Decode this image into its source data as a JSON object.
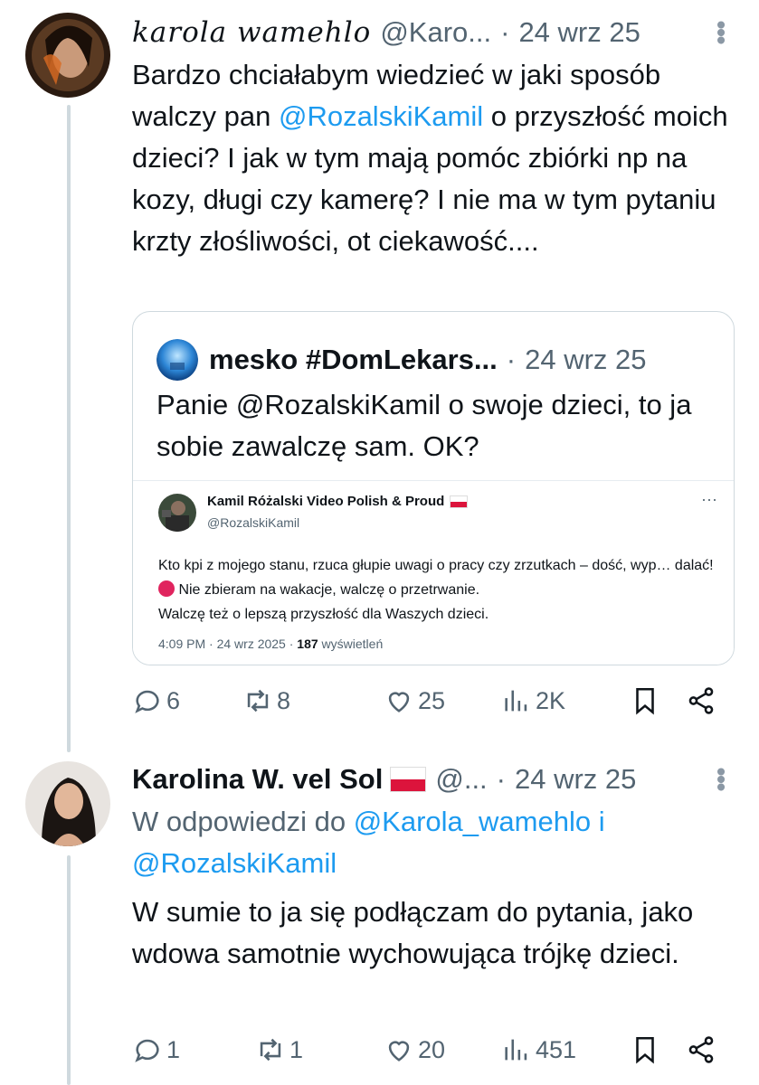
{
  "tweet1": {
    "author_name": "karola wamehlo",
    "handle": "@Karo...",
    "separator": "·",
    "date": "24 wrz 25",
    "text_pre": "Bardzo chciałabym wiedzieć w jaki sposób walczy pan ",
    "mention": "@RozalskiKamil",
    "text_post": " o przyszłość moich dzieci? I jak w tym mają pomóc zbiórki np na kozy, długi czy kamerę? I nie ma w tym pytaniu krzty złośliwości, ot ciekawość....",
    "quote": {
      "author_name": "mesko #DomLekars...",
      "separator": "·",
      "date": "24 wrz 25",
      "text": "Panie @RozalskiKamil o swoje dzieci, to ja sobie zawalczę sam. OK?",
      "embedded": {
        "name": "Kamil Różalski Video Polish & Proud",
        "handle": "@RozalskiKamil",
        "more": "···",
        "line1": "Kto kpi z mojego stanu, rzuca głupie uwagi o pracy czy zrzutkach – dość, wyp… dalać!",
        "line2": " Nie zbieram na wakacje, walczę o przetrwanie.",
        "line3": "Walczę też o lepszą przyszłość dla Waszych dzieci.",
        "meta_time": "4:09 PM · 24 wrz 2025 · ",
        "meta_views": "187",
        "meta_views_label": " wyświetleń"
      }
    },
    "actions": {
      "replies": "6",
      "reposts": "8",
      "likes": "25",
      "views": "2K"
    }
  },
  "tweet2": {
    "author_name": "Karolina W. vel Sol",
    "handle": "@...",
    "separator": "·",
    "date": "24 wrz 25",
    "reply_prefix": "W odpowiedzi do ",
    "reply_to_1": "@Karola_wamehlo",
    "reply_and": " i",
    "reply_to_2": "@RozalskiKamil",
    "text": "W sumie to ja się podłączam do pytania, jako wdowa samotnie wychowująca trójkę dzieci.",
    "actions": {
      "replies": "1",
      "reposts": "1",
      "likes": "20",
      "views": "451"
    }
  },
  "icons": {
    "more": "more-vertical-icon",
    "reply": "reply-icon",
    "repost": "repost-icon",
    "like": "heart-icon",
    "views": "views-chart-icon",
    "bookmark": "bookmark-icon",
    "share": "share-icon"
  },
  "colors": {
    "accent": "#1d9bf0",
    "muted": "#536471",
    "border": "#cfd9de"
  }
}
